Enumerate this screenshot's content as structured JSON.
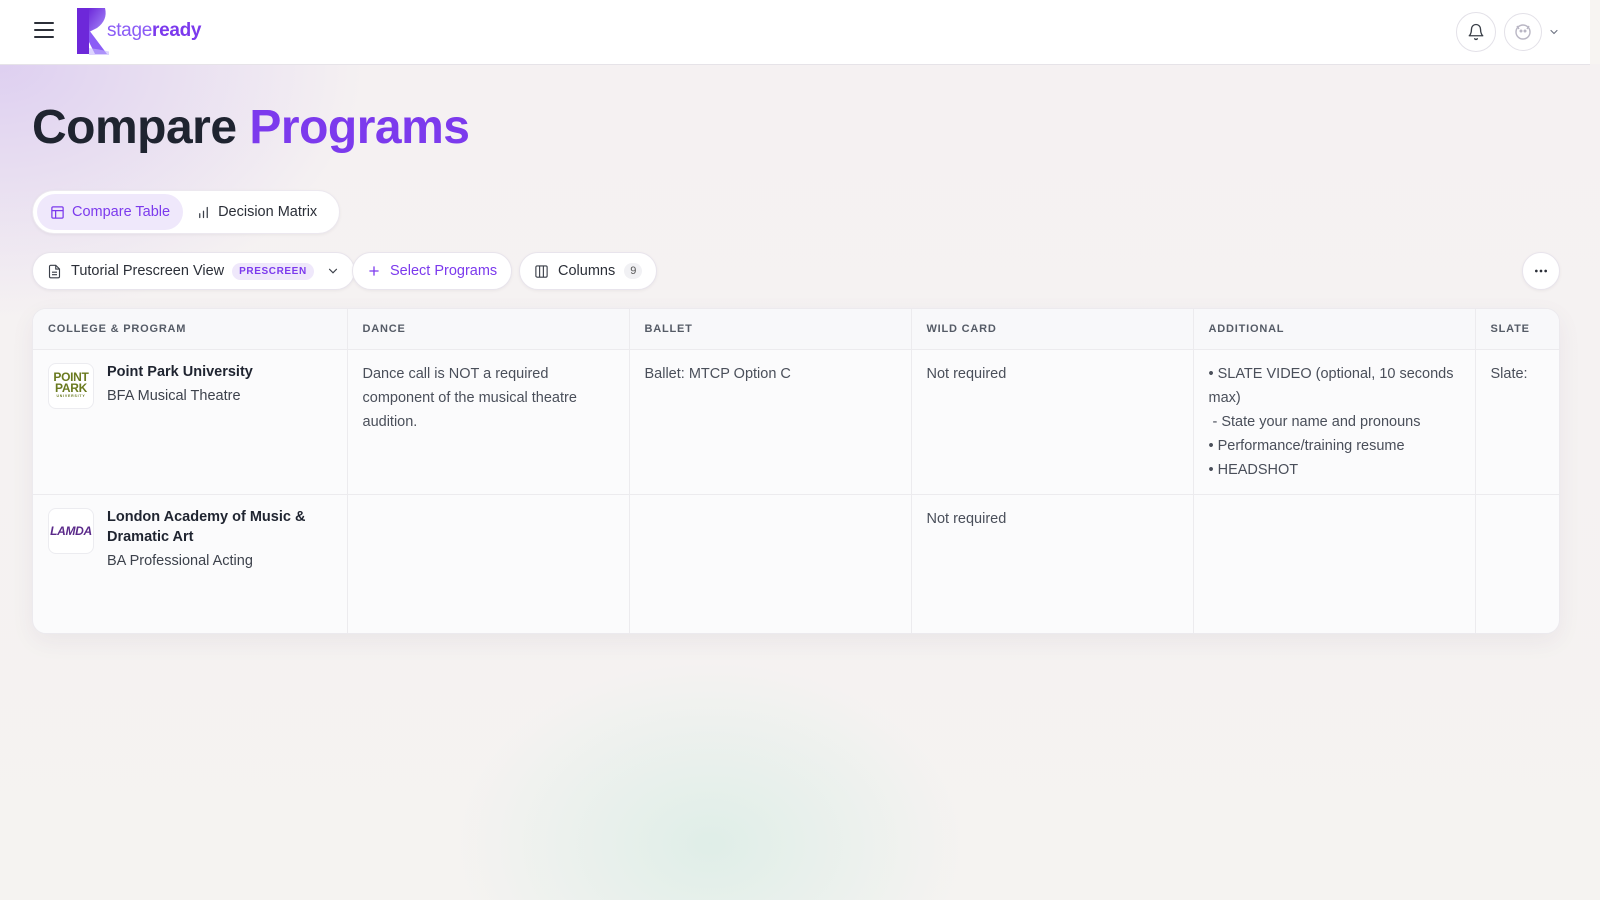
{
  "app": {
    "brand_part1": "stage",
    "brand_part2": "ready"
  },
  "page": {
    "title_part1": "Compare",
    "title_part2": "Programs"
  },
  "view_toggle": {
    "compare_table": "Compare Table",
    "decision_matrix": "Decision Matrix",
    "active": "compare_table"
  },
  "toolbar": {
    "view_name": "Tutorial Prescreen View",
    "view_badge": "PRESCREEN",
    "select_programs": "Select Programs",
    "columns_label": "Columns",
    "columns_count": "9"
  },
  "table": {
    "headers": [
      "COLLEGE & PROGRAM",
      "DANCE",
      "BALLET",
      "WILD CARD",
      "ADDITIONAL",
      "SLATE"
    ],
    "rows": [
      {
        "logo_line1": "POINT",
        "logo_line2": "PARK",
        "logo_line3": "UNIVERSITY",
        "college": "Point Park University",
        "program": "BFA Musical Theatre",
        "dance": "Dance call is NOT a required component of the musical theatre audition.",
        "ballet": "Ballet: MTCP Option C",
        "wild_card": "Not required",
        "additional": [
          "• SLATE VIDEO (optional, 10 seconds max)",
          " - State your name and pronouns",
          "• Performance/training resume",
          "• HEADSHOT"
        ],
        "slate": "Slate:"
      },
      {
        "logo_text": "LAMDA",
        "college": "London Academy of Music & Dramatic Art",
        "program": "BA Professional Acting",
        "dance": "",
        "ballet": "",
        "wild_card": "Not required",
        "additional": [],
        "slate": ""
      }
    ]
  },
  "colors": {
    "accent": "#7c3aed",
    "accent_soft": "#efe8fb",
    "text": "#1f2430"
  }
}
